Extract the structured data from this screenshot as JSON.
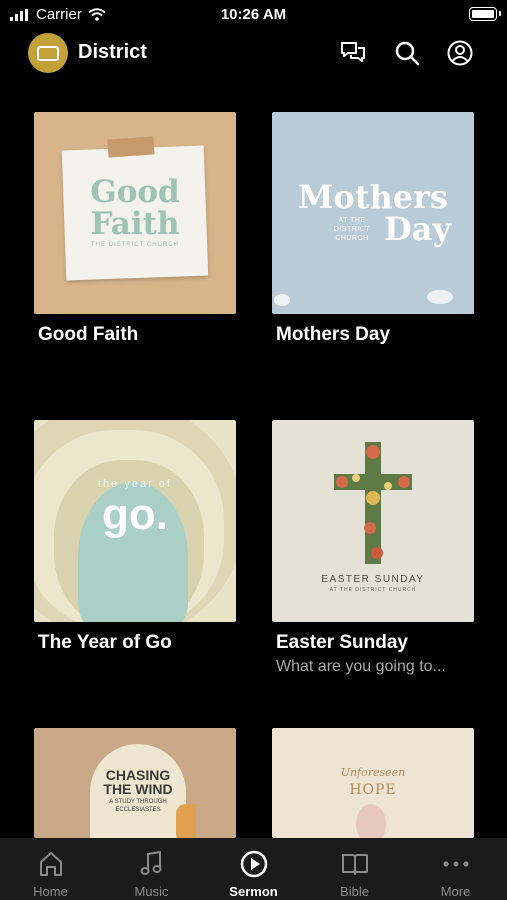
{
  "status_bar": {
    "carrier": "Carrier",
    "time": "10:26 AM"
  },
  "header": {
    "title": "District"
  },
  "series": [
    {
      "title": "Good Faith",
      "subtitle": "",
      "art_line1": "Good",
      "art_line2": "Faith",
      "art_small": "THE DISTRICT CHURCH"
    },
    {
      "title": "Mothers Day",
      "subtitle": "",
      "art_line1": "Mothers",
      "art_line2": "Day",
      "art_small": "AT THE DISTRICT CHURCH"
    },
    {
      "title": "The Year of Go",
      "subtitle": "",
      "art_line1": "go.",
      "art_small": "the year of"
    },
    {
      "title": "Easter Sunday",
      "subtitle": "What are you going to...",
      "art_line1": "EASTER SUNDAY",
      "art_small": "AT THE DISTRICT CHURCH"
    },
    {
      "title": "",
      "subtitle": "",
      "art_line1": "CHASING THE WIND",
      "art_small": "A STUDY THROUGH ECCLESIASTES"
    },
    {
      "title": "",
      "subtitle": "",
      "art_line1": "HOPE",
      "art_small": "Unforeseen"
    }
  ],
  "tabs": [
    {
      "label": "Home",
      "icon": "home-icon"
    },
    {
      "label": "Music",
      "icon": "music-note-icon"
    },
    {
      "label": "Sermon",
      "icon": "play-circle-icon",
      "active": true
    },
    {
      "label": "Bible",
      "icon": "book-icon"
    },
    {
      "label": "More",
      "icon": "more-dots-icon"
    }
  ],
  "colors": {
    "background": "#000000",
    "accent": "#c2a238",
    "tab_bar": "#1b1b1b"
  }
}
